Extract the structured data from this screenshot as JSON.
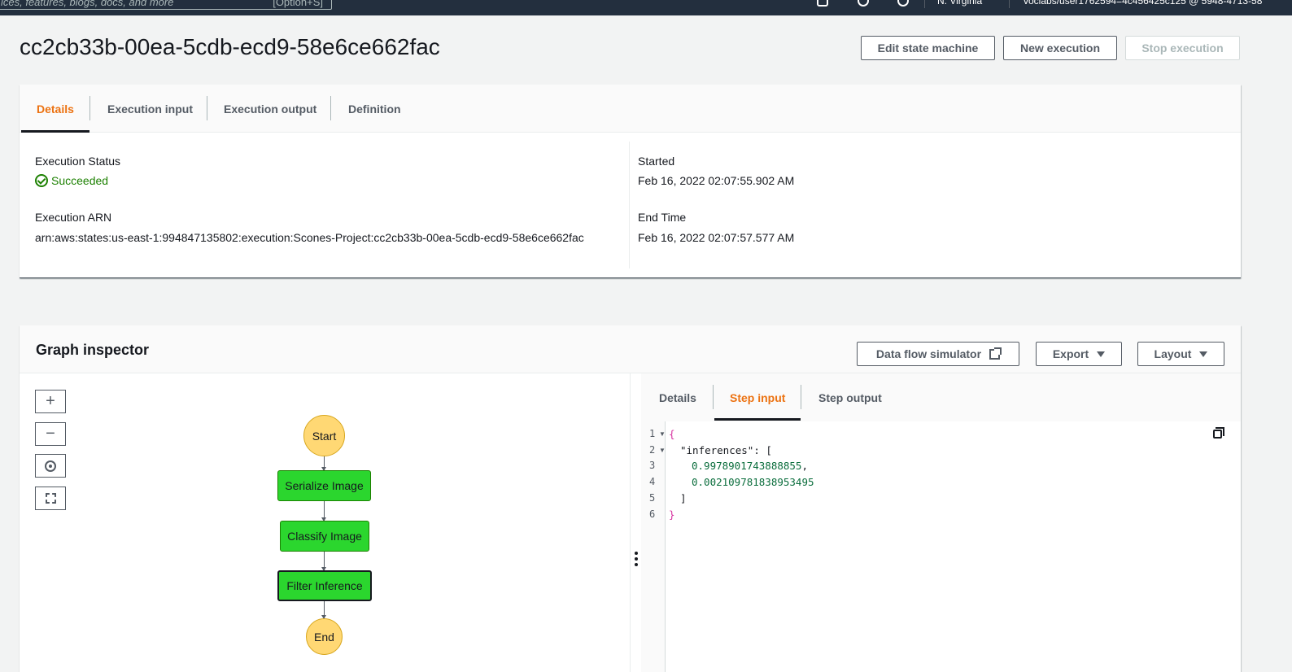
{
  "topnav": {
    "search_placeholder": "ices, features, blogs, docs, and more",
    "search_shortcut": "[Option+S]",
    "region": "N. Virginia",
    "account": "voclabs/user1762594=4c456425c125 @ 5948-4713-58"
  },
  "header": {
    "title": "cc2cb33b-00ea-5cdb-ecd9-58e6ce662fac",
    "edit_label": "Edit state machine",
    "new_execution_label": "New execution",
    "stop_execution_label": "Stop execution"
  },
  "details_tabs": [
    "Details",
    "Execution input",
    "Execution output",
    "Definition"
  ],
  "details": {
    "status_label": "Execution Status",
    "status_value": "Succeeded",
    "arn_label": "Execution ARN",
    "arn_value": "arn:aws:states:us-east-1:994847135802:execution:Scones-Project:cc2cb33b-00ea-5cdb-ecd9-58e6ce662fac",
    "started_label": "Started",
    "started_value": "Feb 16, 2022 02:07:55.902 AM",
    "end_label": "End Time",
    "end_value": "Feb 16, 2022 02:07:57.577 AM"
  },
  "graph": {
    "title": "Graph inspector",
    "simulator_label": "Data flow simulator",
    "export_label": "Export",
    "layout_label": "Layout",
    "zoom_in": "+",
    "zoom_out": "−",
    "nodes": {
      "start": "Start",
      "serialize": "Serialize Image",
      "classify": "Classify Image",
      "filter": "Filter Inference",
      "end": "End"
    }
  },
  "step_tabs": [
    "Details",
    "Step input",
    "Step output"
  ],
  "code": {
    "lines": [
      "1",
      "2",
      "3",
      "4",
      "5",
      "6"
    ],
    "l1": "{",
    "l2_key": "\"inferences\"",
    "l2_rest": ": [",
    "l3": "0.9978901743888855",
    "l4": "0.002109781838953495",
    "l5": "]",
    "l6": "}"
  },
  "colors": {
    "nav": "#232f3e",
    "accent_tab": "#ec7211",
    "success": "#1d8102",
    "task_node": "#2bd62e",
    "terminal_node": "#ffd874"
  }
}
